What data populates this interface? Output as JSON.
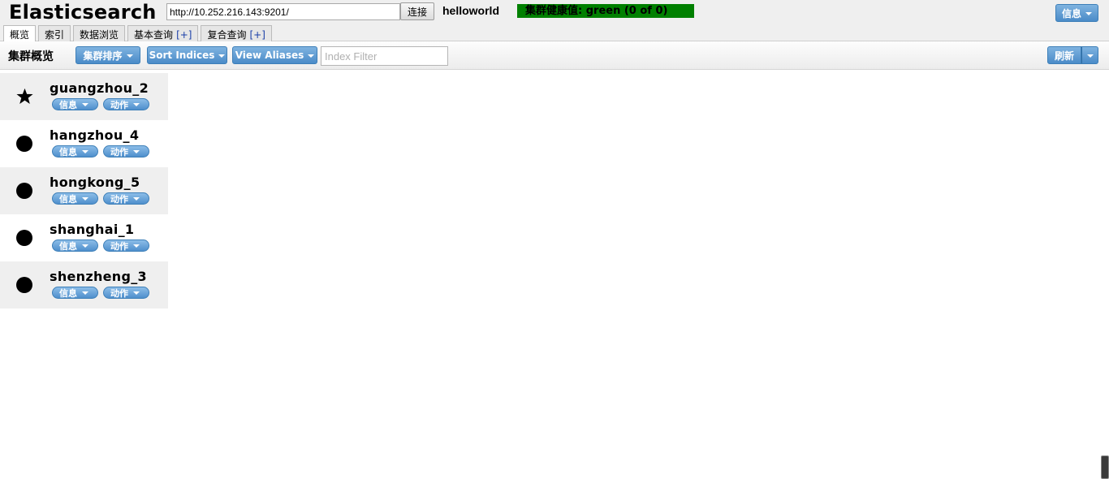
{
  "header": {
    "app_title": "Elasticsearch",
    "url_value": "http://10.252.216.143:9201/",
    "connect_label": "连接",
    "cluster_name": "helloworld",
    "health_text": "集群健康值: green (0 of 0)",
    "health_color": "#008000",
    "info_button_label": "信息"
  },
  "tabs": [
    {
      "label": "概览",
      "plus": ""
    },
    {
      "label": "索引",
      "plus": ""
    },
    {
      "label": "数据浏览",
      "plus": ""
    },
    {
      "label": "基本查询",
      "plus": "[+]"
    },
    {
      "label": "复合查询",
      "plus": "[+]"
    }
  ],
  "toolbar": {
    "title": "集群概览",
    "cluster_sort_label": "集群排序",
    "sort_indices_label": "Sort Indices",
    "view_aliases_label": "View Aliases",
    "index_filter_placeholder": "Index Filter",
    "refresh_label": "刷新"
  },
  "nodes": [
    {
      "name": "guangzhou_2",
      "icon": "star-icon",
      "info_label": "信息",
      "action_label": "动作"
    },
    {
      "name": "hangzhou_4",
      "icon": "circle-icon",
      "info_label": "信息",
      "action_label": "动作"
    },
    {
      "name": "hongkong_5",
      "icon": "circle-icon",
      "info_label": "信息",
      "action_label": "动作"
    },
    {
      "name": "shanghai_1",
      "icon": "circle-icon",
      "info_label": "信息",
      "action_label": "动作"
    },
    {
      "name": "shenzheng_3",
      "icon": "circle-icon",
      "info_label": "信息",
      "action_label": "动作"
    }
  ],
  "colors": {
    "accent_blue": "#4a8bc8",
    "row_shade": "#efefef"
  }
}
